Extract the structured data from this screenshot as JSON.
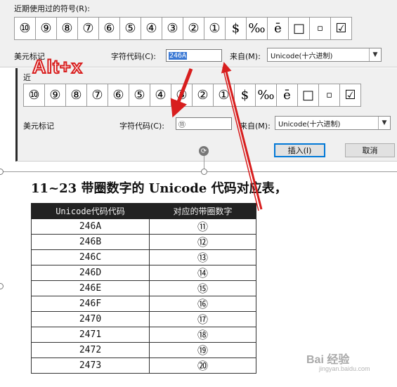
{
  "dialog": {
    "recent_label": "近期使用过的符号(R):",
    "recent_symbols_top": [
      "⑩",
      "⑨",
      "⑧",
      "⑦",
      "⑥",
      "⑤",
      "④",
      "③",
      "②",
      "①",
      "$",
      "‰",
      "ē",
      "□",
      "▫",
      "☑"
    ],
    "recent_symbols_mid": [
      "⑩",
      "⑨",
      "⑧",
      "⑦",
      "⑥",
      "⑤",
      "④",
      "③",
      "②",
      "①",
      "$",
      "‰",
      "ē",
      "□",
      "▫",
      "☑"
    ],
    "name_label": "美元标记",
    "code_label": "字符代码(C):",
    "code_value_top": "246A",
    "code_value_mid": "⑪",
    "from_label": "来自(M):",
    "from_value": "Unicode(十六进制)",
    "insert_label": "插入(I)",
    "cancel_label": "取消",
    "partial_label": "近"
  },
  "annotation": {
    "hint": "Alt+x",
    "arrow_color": "#d81e1e"
  },
  "document": {
    "title": "11~23 带圈数字的 Unicode 代码对应表，",
    "headers": [
      "Unicode代码代码",
      "对应的带圈数字"
    ],
    "rows": [
      {
        "code": "246A",
        "symbol": "⑪"
      },
      {
        "code": "246B",
        "symbol": "⑫"
      },
      {
        "code": "246C",
        "symbol": "⑬"
      },
      {
        "code": "246D",
        "symbol": "⑭"
      },
      {
        "code": "246E",
        "symbol": "⑮"
      },
      {
        "code": "246F",
        "symbol": "⑯"
      },
      {
        "code": "2470",
        "symbol": "⑰"
      },
      {
        "code": "2471",
        "symbol": "⑱"
      },
      {
        "code": "2472",
        "symbol": "⑲"
      },
      {
        "code": "2473",
        "symbol": "⑳"
      }
    ]
  },
  "watermark": {
    "brand": "Bai 经验",
    "url": "jingyan.baidu.com"
  }
}
